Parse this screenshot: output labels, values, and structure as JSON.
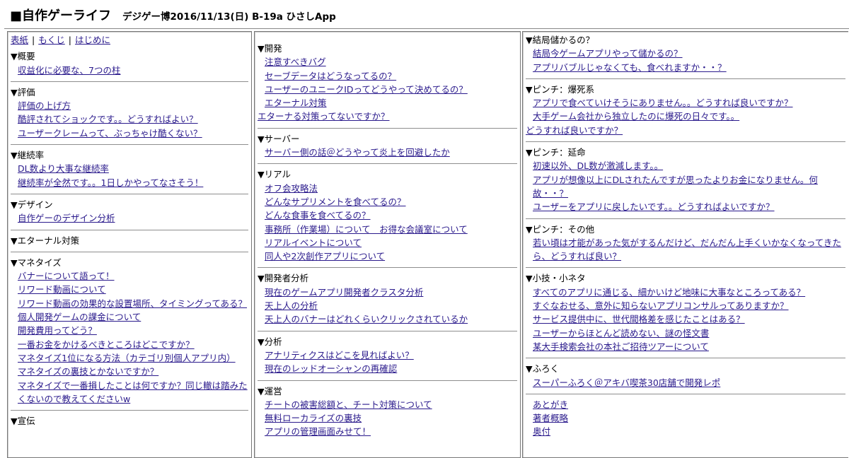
{
  "header": {
    "title": "■自作ゲーライフ",
    "event": "デジゲー博2016/11/13(日) B-19a ひさしApp"
  },
  "top_links": [
    "表紙",
    "もくじ",
    "はじめに"
  ],
  "col1": [
    {
      "title": "▼概要",
      "items": [
        "収益化に必要な、7つの柱"
      ]
    },
    {
      "title": "▼評価",
      "items": [
        "評価の上げ方",
        "酷評されてショックです。。どうすればよい？",
        "ユーザークレームって、ぶっちゃけ酷くない？"
      ]
    },
    {
      "title": "▼継続率",
      "items": [
        "DL数より大事な継続率",
        "継続率が全然です。。1日しかやってなさそう！"
      ]
    },
    {
      "title": "▼デザイン",
      "items": [
        "自作ゲーのデザイン分析"
      ]
    },
    {
      "title": "▼エターナル対策",
      "items": []
    },
    {
      "title": "▼マネタイズ",
      "items": [
        "バナーについて語って！",
        "リワード動画について",
        "リワード動画の効果的な設置場所、タイミングってある？",
        "個人開発ゲームの課金について",
        "開発費用ってどう？",
        "一番お金をかけるべきところはどこですか？",
        "マネタイズ1位になる方法（カテゴリ別個人アプリ内）",
        "マネタイズの裏技とかないですか？",
        "マネタイズで一番損したことは何ですか？同じ轍は踏みたくないので教えてくださいw"
      ]
    },
    {
      "title": "▼宣伝",
      "items": []
    }
  ],
  "col2": [
    {
      "title": "▼開発",
      "items": [
        "注意すべきバグ",
        "セーブデータはどうなってるの？",
        "ユーザーのユニークIDってどうやって決めてるの？",
        "エターナル対策"
      ],
      "flush": "エターナる対策ってないですか？"
    },
    {
      "title": "▼サーバー",
      "items": [
        "サーバー側の話＠どうやって炎上を回避したか"
      ]
    },
    {
      "title": "▼リアル",
      "items": [
        "オフ会攻略法",
        "どんなサプリメントを食べてるの？",
        "どんな食事を食べてるの？",
        "事務所（作業場）について　お得な会議室について",
        "リアルイベントについて",
        "同人や2次創作アプリについて"
      ]
    },
    {
      "title": "▼開発者分析",
      "items": [
        "現在のゲームアプリ開発者クラスタ分析",
        "天上人の分析",
        "天上人のバナーはどれくらいクリックされているか"
      ]
    },
    {
      "title": "▼分析",
      "items": [
        "アナリティクスはどこを見ればよい？",
        "現在のレッドオーシャンの再確認"
      ]
    },
    {
      "title": "▼運営",
      "items": [
        "チートの被害総額と、チート対策について",
        "無料ローカライズの裏技",
        "アプリの管理画面みせて！"
      ]
    }
  ],
  "col3": [
    {
      "title": "▼結局儲かるの？",
      "items": [
        "結局今ゲームアプリやって儲かるの？",
        "アプリバブルじゃなくても、食べれますか・・？"
      ]
    },
    {
      "title": "▼ピンチ：爆死系",
      "items": [
        "アプリで食べていけそうにありません。。どうすれば良いですか？",
        "大手ゲーム会社から独立したのに爆死の日々です。。"
      ],
      "flush": "どうすれば良いですか？"
    },
    {
      "title": "▼ピンチ：延命",
      "items": [
        "初速以外、DL数が激減します。。",
        "アプリが想像以上にDLされたんですが思ったよりお金になりません。何故・・？",
        "ユーザーをアプリに戻したいです。。どうすればよいですか？"
      ]
    },
    {
      "title": "▼ピンチ：その他",
      "items": [
        "若い頃は才能があった気がするんだけど、だんだん上手くいかなくなってきたら、どうすれば良い？"
      ]
    },
    {
      "title": "▼小技・小ネタ",
      "items": [
        "すべてのアプリに通じる、細かいけど地味に大事なところってある？",
        "すぐなおせる、意外に知らないアプリコンサルってありますか？",
        "サービス提供中に、世代間格差を感じたことはある？",
        "ユーザーからほとんど読めない、謎の怪文書",
        "某大手検索会社の本社ご招待ツアーについて"
      ]
    },
    {
      "title": "▼ふろく",
      "items": [
        "スーパーふろく＠アキバ喫茶30店舗で開発レポ"
      ]
    },
    {
      "title": "",
      "items": [
        "あとがき",
        "著者概略",
        "奥付"
      ]
    }
  ]
}
